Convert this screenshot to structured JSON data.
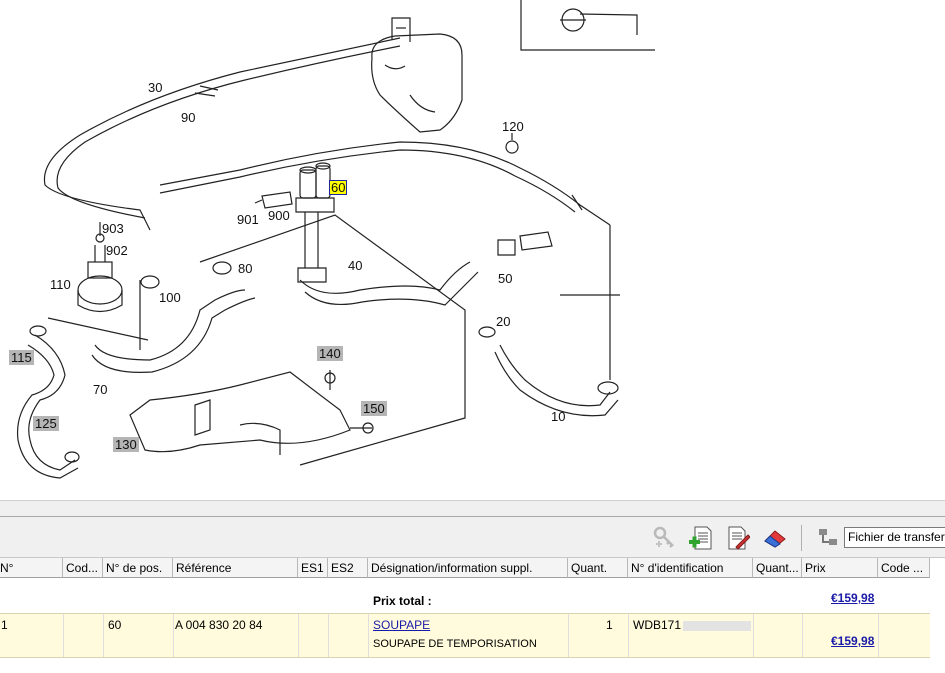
{
  "diagram": {
    "callouts": [
      {
        "id": "30",
        "label": "30"
      },
      {
        "id": "90",
        "label": "90"
      },
      {
        "id": "120",
        "label": "120"
      },
      {
        "id": "60",
        "label": "60"
      },
      {
        "id": "901",
        "label": "901"
      },
      {
        "id": "900",
        "label": "900"
      },
      {
        "id": "903",
        "label": "903"
      },
      {
        "id": "902",
        "label": "902"
      },
      {
        "id": "110",
        "label": "110"
      },
      {
        "id": "80",
        "label": "80"
      },
      {
        "id": "100",
        "label": "100"
      },
      {
        "id": "40",
        "label": "40"
      },
      {
        "id": "50",
        "label": "50"
      },
      {
        "id": "20",
        "label": "20"
      },
      {
        "id": "115",
        "label": "115"
      },
      {
        "id": "70",
        "label": "70"
      },
      {
        "id": "140",
        "label": "140"
      },
      {
        "id": "125",
        "label": "125"
      },
      {
        "id": "150",
        "label": "150"
      },
      {
        "id": "130",
        "label": "130"
      },
      {
        "id": "10",
        "label": "10"
      }
    ]
  },
  "toolbar": {
    "icons": [
      "key-add-icon",
      "document-add-icon",
      "document-edit-icon",
      "eraser-icon",
      "transfer-icon"
    ],
    "transfer_field_value": "Fichier de transfert l"
  },
  "grid": {
    "columns": [
      "N°",
      "Cod...",
      "N° de pos.",
      "Référence",
      "ES1",
      "ES2",
      "Désignation/information suppl.",
      "Quant.",
      "N° d'identification",
      "Quant...",
      "Prix",
      "Code ..."
    ],
    "total_label": "Prix total :",
    "total_price": "€159,98",
    "rows": [
      {
        "n": "1",
        "pos": "60",
        "reference": "A 004 830 20 84",
        "designation": "SOUPAPE",
        "designation_suppl": "SOUPAPE DE TEMPORISATION",
        "quantity": "1",
        "vin": "WDB171",
        "price": "€159,98"
      }
    ]
  },
  "colors": {
    "highlight": "#ffff00",
    "link": "#1a1aa8",
    "row_selected": "#fffbdc"
  }
}
